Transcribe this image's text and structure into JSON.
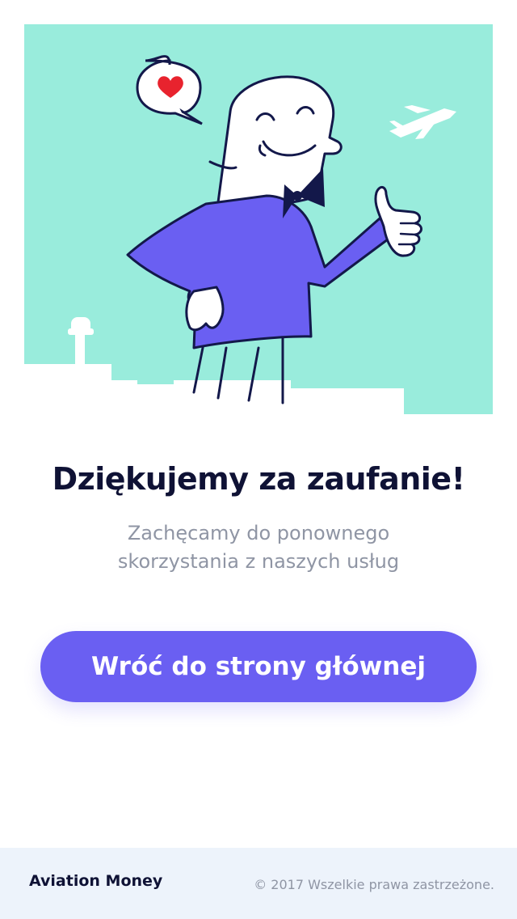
{
  "hero": {
    "illustration": "smiling-man-thumbs-up-with-heart-and-airplane",
    "colors": {
      "background": "#99ecdc",
      "shirt": "#6a5ff2",
      "outline": "#13184a",
      "heart": "#e8232e"
    }
  },
  "content": {
    "title": "Dziękujemy za zaufanie!",
    "subtitle": "Zachęcamy do ponownego skorzystania z naszych usług"
  },
  "cta": {
    "label": "Wróć do strony głównej",
    "color": "#6a5ff2"
  },
  "footer": {
    "brand": "Aviation Money",
    "copyright": "© 2017 Wszelkie prawa zastrzeżone."
  }
}
